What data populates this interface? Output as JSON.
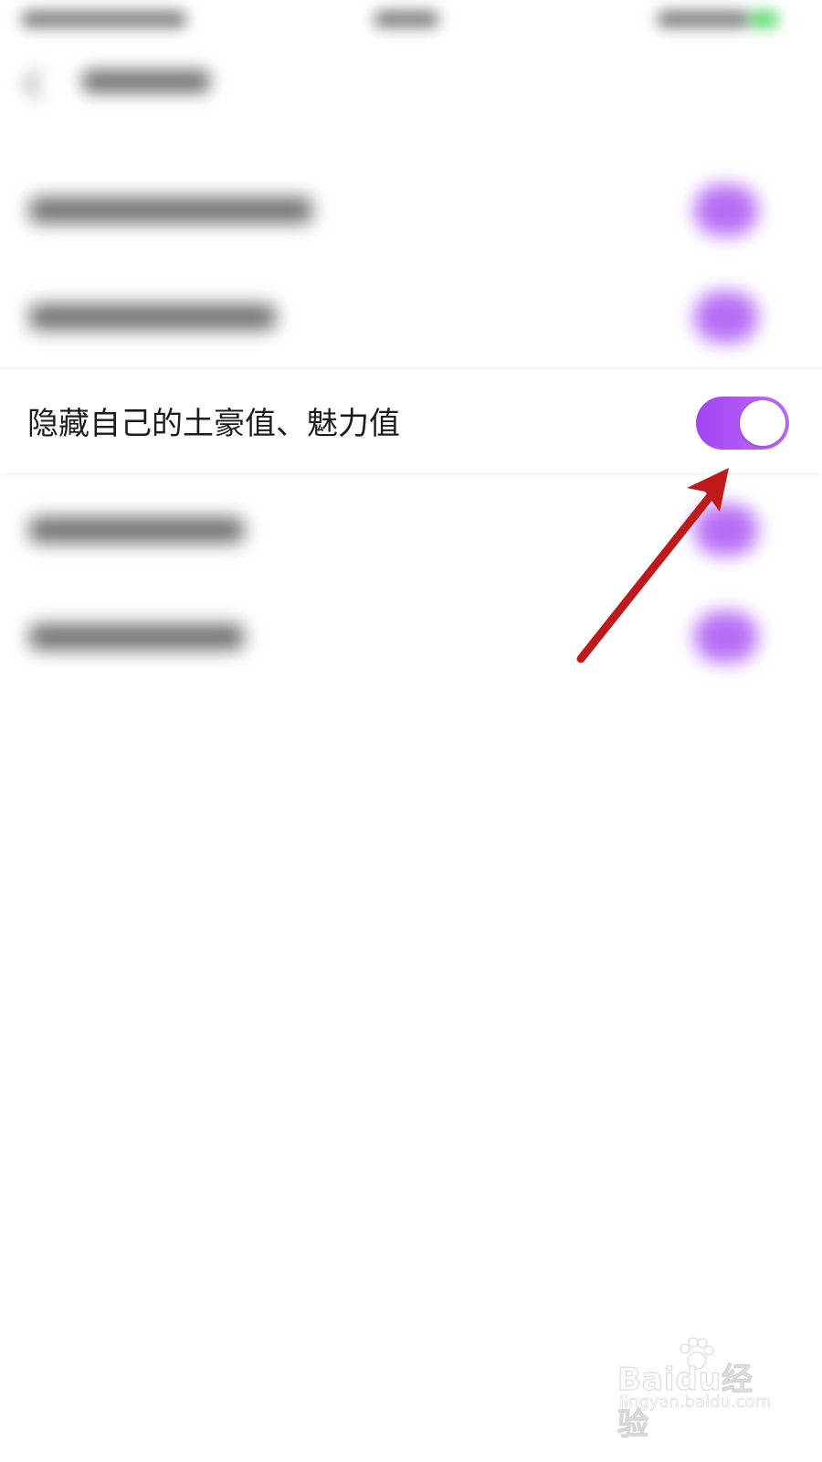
{
  "settings": {
    "hide_value_row": {
      "label": "隐藏自己的土豪值、魅力值",
      "toggle_on": true
    }
  },
  "colors": {
    "toggle_gradient_start": "#9f45f3",
    "toggle_gradient_end": "#c06cf7",
    "annotation_arrow": "#c0191b",
    "label_text": "#1c1c1c"
  },
  "icons": {
    "toggle": "toggle-switch",
    "back": "chevron-left-icon",
    "annotation": "red-arrow-icon"
  },
  "watermark": {
    "logo_text": "Baidu经验",
    "url": "jingyan.baidu.com"
  }
}
